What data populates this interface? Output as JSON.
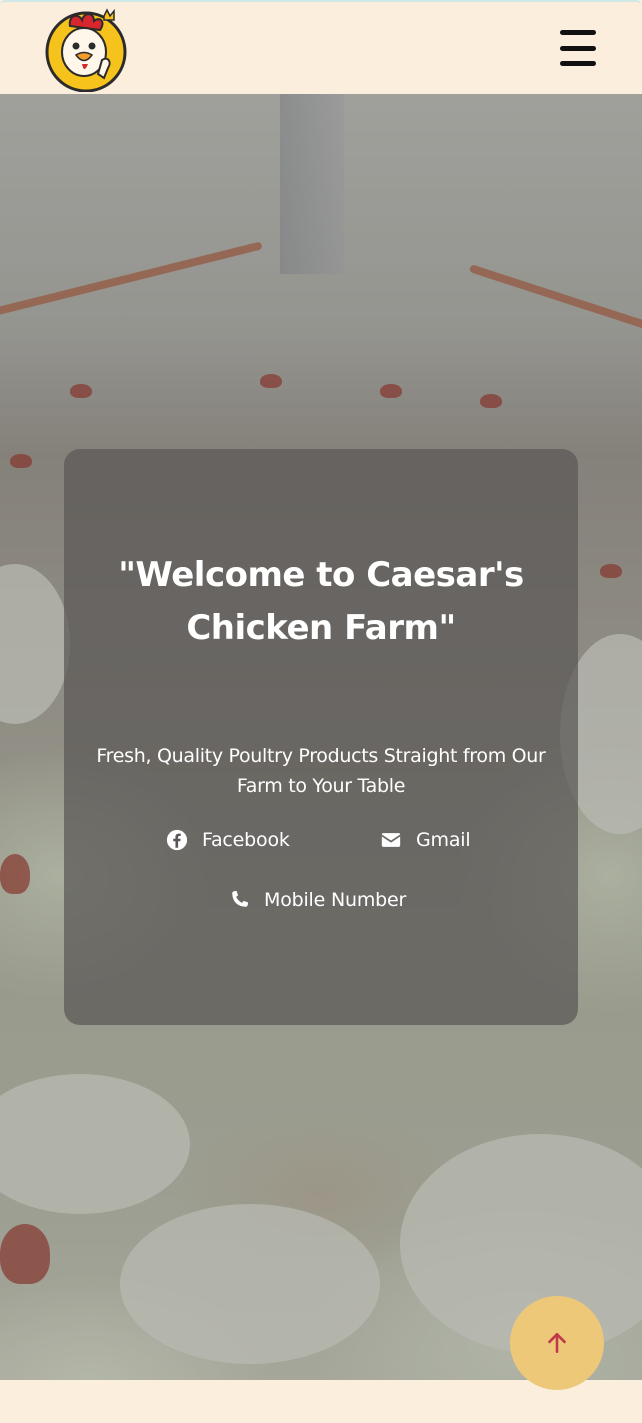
{
  "header": {
    "logo_icon": "rooster-mascot-logo",
    "menu_icon": "hamburger-menu-icon"
  },
  "hero": {
    "title": "\"Welcome to Caesar's Chicken Farm\"",
    "subtitle": "Fresh, Quality Poultry Products Straight from Our Farm to Your Table",
    "contacts": [
      {
        "label": "Facebook",
        "icon": "facebook-icon"
      },
      {
        "label": "Gmail",
        "icon": "envelope-icon"
      },
      {
        "label": "Mobile Number",
        "icon": "phone-icon"
      }
    ]
  },
  "scroll_top": {
    "icon": "arrow-up-icon",
    "color": "#edc878",
    "arrow_color": "#c0394b"
  },
  "colors": {
    "header_bg": "#fbeedc",
    "card_bg": "rgba(90,88,86,0.72)",
    "text": "#ffffff"
  }
}
